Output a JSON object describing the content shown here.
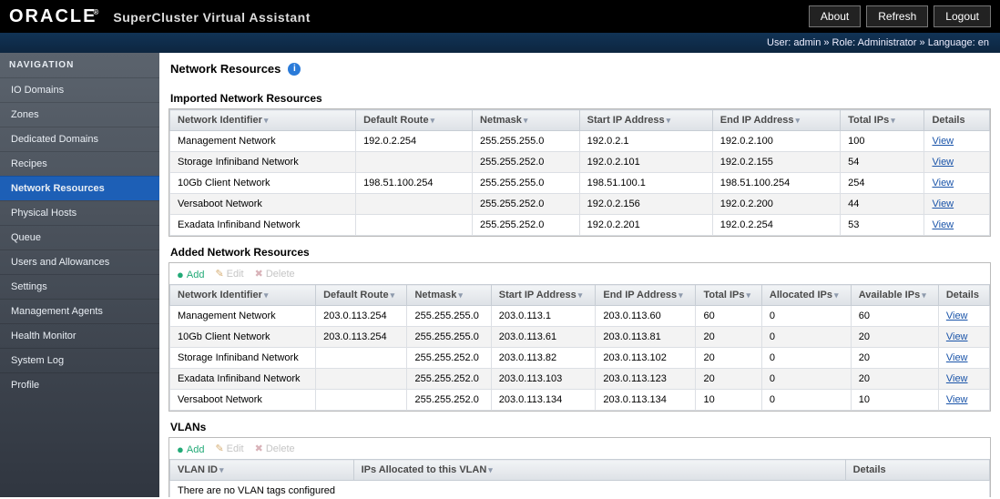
{
  "app": {
    "logo_main": "ORACLE",
    "logo_sub": "SuperCluster Virtual Assistant",
    "buttons": {
      "about": "About",
      "refresh": "Refresh",
      "logout": "Logout"
    },
    "userline": "User: admin » Role: Administrator » Language: en"
  },
  "nav": {
    "title": "NAVIGATION",
    "items": [
      "IO Domains",
      "Zones",
      "Dedicated Domains",
      "Recipes",
      "Network Resources",
      "Physical Hosts",
      "Queue",
      "Users and Allowances",
      "Settings",
      "Management Agents",
      "Health Monitor",
      "System Log",
      "Profile"
    ],
    "active_index": 4
  },
  "page": {
    "title": "Network Resources"
  },
  "sections": {
    "imported_title": "Imported Network Resources",
    "added_title": "Added Network Resources",
    "vlan_title": "VLANs",
    "vlan_empty": "There are no VLAN tags configured"
  },
  "toolbar": {
    "add": "Add",
    "edit": "Edit",
    "delete": "Delete"
  },
  "tables": {
    "imported_cols": [
      "Network Identifier",
      "Default Route",
      "Netmask",
      "Start IP Address",
      "End IP Address",
      "Total IPs",
      "Details"
    ],
    "added_cols": [
      "Network Identifier",
      "Default Route",
      "Netmask",
      "Start IP Address",
      "End IP Address",
      "Total IPs",
      "Allocated IPs",
      "Available IPs",
      "Details"
    ],
    "vlan_cols": [
      "VLAN ID",
      "IPs Allocated to this VLAN",
      "Details"
    ],
    "view_label": "View",
    "imported": [
      {
        "nid": "Management Network",
        "route": "192.0.2.254",
        "mask": "255.255.255.0",
        "start": "192.0.2.1",
        "end": "192.0.2.100",
        "total": "100"
      },
      {
        "nid": "Storage Infiniband Network",
        "route": "",
        "mask": "255.255.252.0",
        "start": "192.0.2.101",
        "end": "192.0.2.155",
        "total": "54"
      },
      {
        "nid": "10Gb Client Network",
        "route": "198.51.100.254",
        "mask": "255.255.255.0",
        "start": "198.51.100.1",
        "end": "198.51.100.254",
        "total": "254"
      },
      {
        "nid": "Versaboot Network",
        "route": "",
        "mask": "255.255.252.0",
        "start": "192.0.2.156",
        "end": "192.0.2.200",
        "total": "44"
      },
      {
        "nid": "Exadata Infiniband Network",
        "route": "",
        "mask": "255.255.252.0",
        "start": "192.0.2.201",
        "end": "192.0.2.254",
        "total": "53"
      }
    ],
    "added": [
      {
        "nid": "Management Network",
        "route": "203.0.113.254",
        "mask": "255.255.255.0",
        "start": "203.0.113.1",
        "end": "203.0.113.60",
        "total": "60",
        "alloc": "0",
        "avail": "60"
      },
      {
        "nid": "10Gb Client Network",
        "route": "203.0.113.254",
        "mask": "255.255.255.0",
        "start": "203.0.113.61",
        "end": "203.0.113.81",
        "total": "20",
        "alloc": "0",
        "avail": "20"
      },
      {
        "nid": "Storage Infiniband Network",
        "route": "",
        "mask": "255.255.252.0",
        "start": "203.0.113.82",
        "end": "203.0.113.102",
        "total": "20",
        "alloc": "0",
        "avail": "20"
      },
      {
        "nid": "Exadata Infiniband Network",
        "route": "",
        "mask": "255.255.252.0",
        "start": "203.0.113.103",
        "end": "203.0.113.123",
        "total": "20",
        "alloc": "0",
        "avail": "20"
      },
      {
        "nid": "Versaboot Network",
        "route": "",
        "mask": "255.255.252.0",
        "start": "203.0.113.134",
        "end": "203.0.113.134",
        "total": "10",
        "alloc": "0",
        "avail": "10"
      }
    ]
  }
}
